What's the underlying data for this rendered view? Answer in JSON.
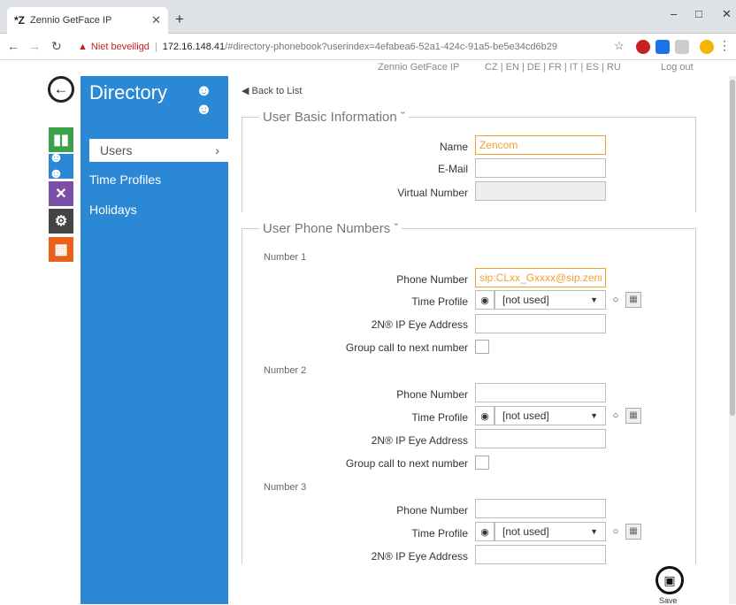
{
  "browser": {
    "tab_title": "Zennio GetFace IP",
    "tab_favicon": "*Z",
    "security_label": "Niet beveiligd",
    "url_host": "172.16.148.41",
    "url_path": "/#directory-phonebook?userindex=4efabea6-52a1-424c-91a5-be5e34cd6b29",
    "minimize": "–",
    "maximize": "□",
    "close": "✕"
  },
  "header": {
    "product": "Zennio GetFace IP",
    "languages": "CZ | EN | DE | FR | IT | ES | RU",
    "logout": "Log out"
  },
  "sidebar": {
    "title": "Directory",
    "items": [
      {
        "label": "Users",
        "active": true
      },
      {
        "label": "Time Profiles"
      },
      {
        "label": "Holidays"
      }
    ]
  },
  "content": {
    "back_link": "Back to List",
    "basic": {
      "title": "User Basic Information",
      "name_label": "Name",
      "name_value": "Zencom",
      "email_label": "E-Mail",
      "email_value": "",
      "virtual_label": "Virtual Number",
      "virtual_value": ""
    },
    "phones": {
      "title": "User Phone Numbers",
      "phone_label": "Phone Number",
      "time_label": "Time Profile",
      "eye_label": "2N® IP Eye Address",
      "group_label": "Group call to next number",
      "not_used": "[not used]",
      "numbers": [
        {
          "label": "Number 1",
          "phone": "sip:CLxx_Gxxxx@sip.zenn"
        },
        {
          "label": "Number 2",
          "phone": ""
        },
        {
          "label": "Number 3",
          "phone": ""
        }
      ]
    },
    "save_label": "Save"
  },
  "colors": {
    "sidebar": "#2b88d4",
    "focus": "#f0a030",
    "status_green": "#3aa24a",
    "users_blue": "#2b88d4",
    "tools_purple": "#7b4fa8",
    "settings_dark": "#444444",
    "grid_orange": "#e8611a"
  }
}
